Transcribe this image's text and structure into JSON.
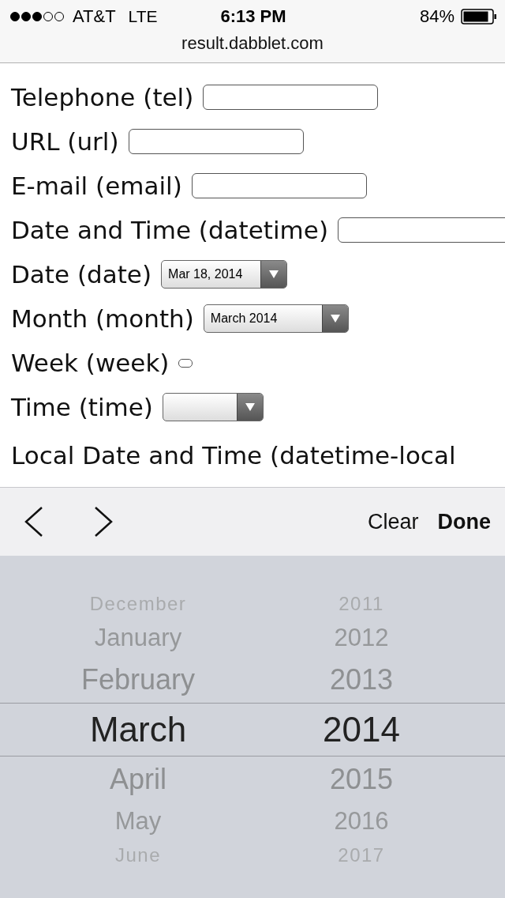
{
  "status_bar": {
    "carrier": "AT&T",
    "network": "LTE",
    "time": "6:13 PM",
    "battery": "84%"
  },
  "address": "result.dabblet.com",
  "form_rows": [
    {
      "label": "Telephone (tel)",
      "kind": "text"
    },
    {
      "label": "URL (url)",
      "kind": "text"
    },
    {
      "label": "E-mail (email)",
      "kind": "text"
    },
    {
      "label": "Date and Time (datetime)",
      "kind": "text"
    },
    {
      "label": "Date (date)",
      "kind": "select",
      "value": "Mar 18, 2014"
    },
    {
      "label": "Month (month)",
      "kind": "select",
      "value": "March 2014"
    },
    {
      "label": "Week (week)",
      "kind": "tiny"
    },
    {
      "label": "Time (time)",
      "kind": "select",
      "value": ""
    },
    {
      "label": "Local Date and Time (datetime-local",
      "kind": "none"
    }
  ],
  "toolbar": {
    "clear": "Clear",
    "done": "Done"
  },
  "picker_rows": [
    {
      "month": "December",
      "year": "2011",
      "selected": false
    },
    {
      "month": "January",
      "year": "2012",
      "selected": false
    },
    {
      "month": "February",
      "year": "2013",
      "selected": false
    },
    {
      "month": "March",
      "year": "2014",
      "selected": true
    },
    {
      "month": "April",
      "year": "2015",
      "selected": false
    },
    {
      "month": "May",
      "year": "2016",
      "selected": false
    },
    {
      "month": "June",
      "year": "2017",
      "selected": false
    }
  ]
}
